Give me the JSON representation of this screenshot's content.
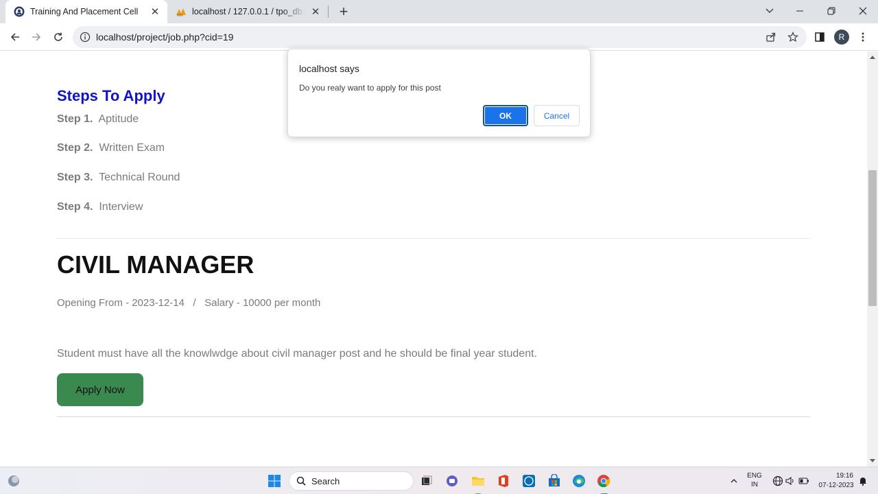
{
  "tabs": [
    {
      "title": "Training And Placement Cell",
      "active": true
    },
    {
      "title": "localhost / 127.0.0.1 / tpo_db / s",
      "active": false
    }
  ],
  "address_bar": {
    "url": "localhost/project/job.php?cid=19"
  },
  "profile_initial": "R",
  "page": {
    "steps_title": "Steps To Apply",
    "steps": [
      {
        "num": "Step 1.",
        "text": "Aptitude"
      },
      {
        "num": "Step 2.",
        "text": "Written Exam"
      },
      {
        "num": "Step 3.",
        "text": "Technical Round"
      },
      {
        "num": "Step 4.",
        "text": "Interview"
      }
    ],
    "job_title": "CIVIL MANAGER",
    "job_meta": "Opening From - 2023-12-14   /   Salary - 10000 per month",
    "job_description": "Student must have all the knowlwdge about civil manager post and he should be final year student.",
    "apply_label": "Apply Now"
  },
  "dialog": {
    "title": "localhost says",
    "message": "Do you realy want to apply for this post",
    "ok_label": "OK",
    "cancel_label": "Cancel"
  },
  "taskbar": {
    "search_placeholder": "Search",
    "language_line1": "ENG",
    "language_line2": "IN",
    "time": "19:16",
    "date": "07-12-2023"
  },
  "colors": {
    "steps_title": "#1212c8",
    "apply_button": "#3a8a4f",
    "dialog_ok": "#1a73e8",
    "tabstrip": "#dfe3e8"
  }
}
